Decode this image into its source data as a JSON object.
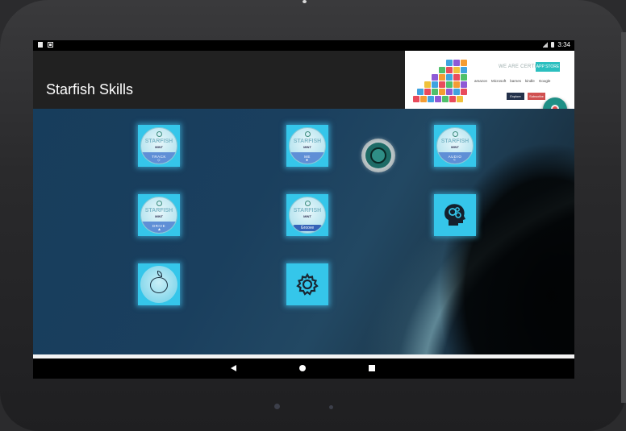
{
  "statusbar": {
    "time": "3:34"
  },
  "appbar": {
    "title": "Starfish Skills",
    "ad": {
      "headline": "WE ARE CERTIFIED",
      "store_label": "APP STORE",
      "partners": [
        "amazon",
        "Microsoft",
        "barnes",
        "kindle",
        "Google"
      ],
      "button1": "Explore Now",
      "button2": "Subscribe Now"
    }
  },
  "tiles": [
    {
      "name": "track",
      "word": "STARFISH",
      "sub": "MINT",
      "label": "TRACK"
    },
    {
      "name": "me",
      "word": "STARFISH",
      "sub": "MINT",
      "label": "ME"
    },
    {
      "name": "audio",
      "word": "STARFISH",
      "sub": "MINT",
      "label": "AUDIO"
    },
    {
      "name": "drive",
      "word": "STARFISH",
      "sub": "MINT",
      "label": "DRIVE"
    },
    {
      "name": "groove",
      "word": "STARFISH",
      "sub": "MINT",
      "label": "Groove"
    },
    {
      "name": "brain",
      "icon": "head-gears-icon"
    },
    {
      "name": "apple",
      "icon": "apple-icon"
    },
    {
      "name": "settings",
      "icon": "gear-icon"
    }
  ],
  "colors": {
    "tile": "#35c6ea",
    "appbar": "#212121",
    "fab": "#1f8f86"
  }
}
